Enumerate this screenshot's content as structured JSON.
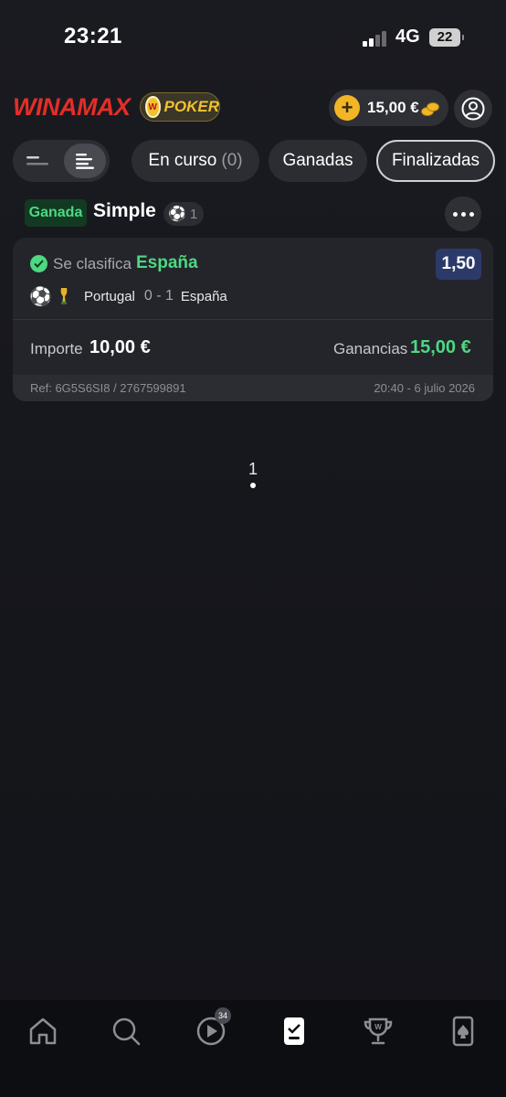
{
  "status_bar": {
    "time": "23:21",
    "network": "4G",
    "battery": "22"
  },
  "header": {
    "logo": "WINAMAX",
    "poker_label": "POKER",
    "balance": "15,00 €"
  },
  "filters": {
    "tabs": [
      {
        "label": "En curso",
        "count": "(0)"
      },
      {
        "label": "Ganadas"
      },
      {
        "label": "Finalizadas",
        "selected": true
      }
    ]
  },
  "bet": {
    "status": "Ganada",
    "type": "Simple",
    "selections_count": "1",
    "market": "Se clasifica",
    "selection": "España",
    "odds": "1,50",
    "match": {
      "home": "Portugal",
      "score": "0 - 1",
      "away": "España"
    },
    "stake_label": "Importe",
    "stake": "10,00 €",
    "winnings_label": "Ganancias",
    "winnings": "15,00 €",
    "ref": "Ref: 6G5S6SI8 / 2767599891",
    "date": "20:40 - 6 julio 2026"
  },
  "pagination": {
    "page": "1"
  },
  "bottom_nav": {
    "live_badge": "34",
    "items": [
      "home-icon",
      "search-icon",
      "live-icon",
      "my-bets-icon",
      "trophy-icon",
      "casino-icon"
    ]
  },
  "colors": {
    "accent_green": "#4dd882",
    "brand_red": "#e52d27",
    "gold": "#f2b524",
    "odds_blue": "#2c3a6a"
  }
}
